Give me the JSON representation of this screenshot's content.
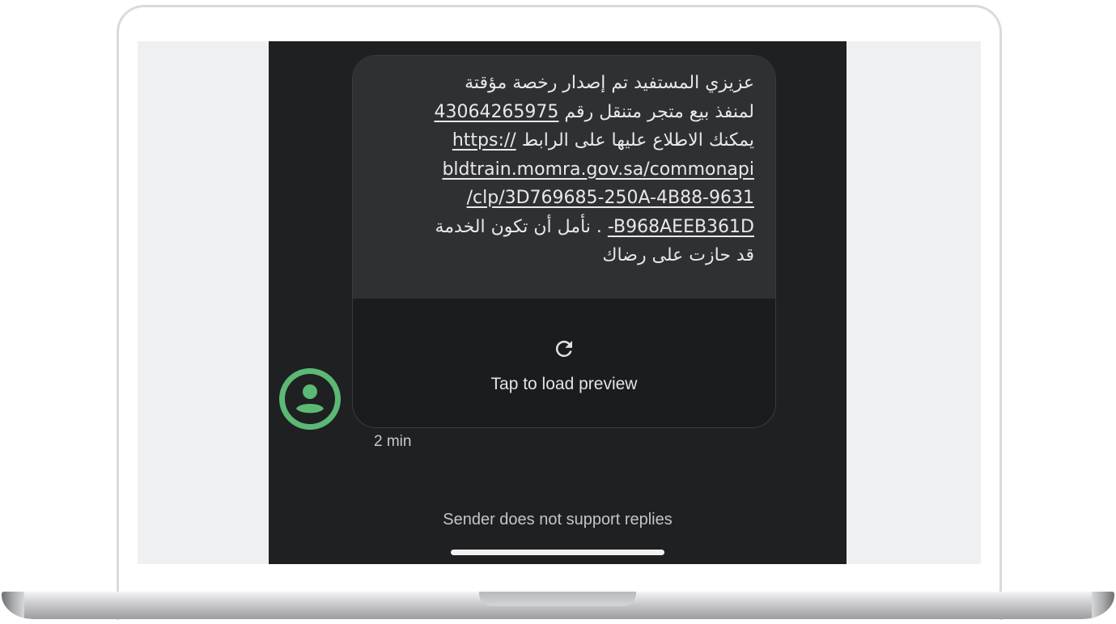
{
  "message": {
    "text_line_1": "عزيزي المستفيد تم إصدار رخصة مؤقتة",
    "text_line_2_prefix": "لمنفذ بيع متجر متنقل رقم ",
    "license_number": "43064265975",
    "text_line_3_prefix": "يمكنك الاطلاع عليها على الرابط ",
    "link_part_1": "https://",
    "link_part_2": "bldtrain.momra.gov.sa/commonapi",
    "link_part_3": "/clp/3D769685-250A-4B88-9631",
    "link_part_4": "-B968AEEB361D",
    "text_line_6_suffix": " . نأمل أن تكون الخدمة",
    "text_line_7": "قد حازت على رضاك"
  },
  "preview": {
    "label": "Tap to load preview",
    "icon": "refresh-icon"
  },
  "sender": {
    "avatar_icon": "person-icon",
    "avatar_color": "#5bb974"
  },
  "timestamp": "2 min",
  "footer": {
    "no_reply_text": "Sender does not support replies"
  },
  "colors": {
    "phone_background": "#1f2022",
    "bubble_background": "#2f3033",
    "text": "#e8e8ea"
  }
}
